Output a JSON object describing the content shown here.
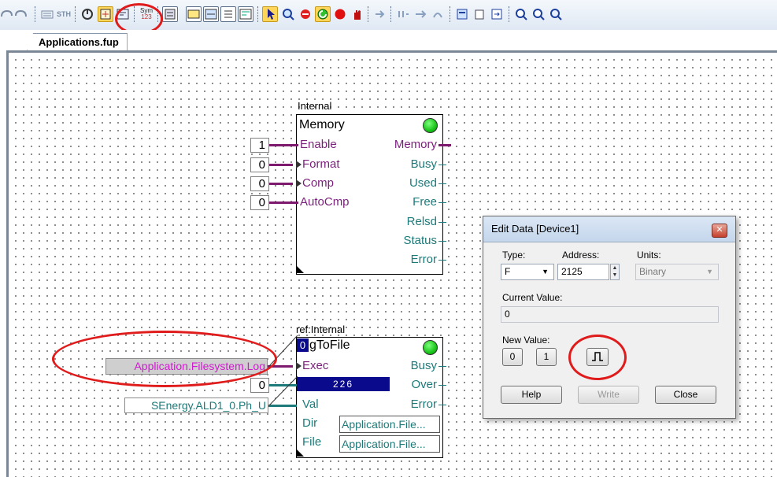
{
  "tab": {
    "label": "Applications.fup"
  },
  "toolbar": {
    "sym_label": "Sym",
    "sym_num": "123",
    "sth_label": "STH"
  },
  "memory_block": {
    "scope": "Internal",
    "title": "Memory",
    "inputs": [
      {
        "name": "Enable",
        "value": "1"
      },
      {
        "name": "Format",
        "value": "0"
      },
      {
        "name": "Comp",
        "value": "0"
      },
      {
        "name": "AutoCmp",
        "value": "0"
      }
    ],
    "outputs": [
      "Memory",
      "Busy",
      "Used",
      "Free",
      "Relsd",
      "Status",
      "Error"
    ]
  },
  "log_block": {
    "scope": "ref:Internal",
    "title_prefix": "0",
    "title": "gToFile",
    "exec_source": "Application.Filesystem.Log",
    "number_input": "0",
    "counter_value": "226",
    "val_source": "SEnergy.ALD1_0.Ph_U",
    "inputs": [
      "Exec",
      "Val",
      "Dir",
      "File"
    ],
    "outputs": [
      "Busy",
      "Over",
      "Error"
    ],
    "dir_value": "Application.File...",
    "file_value": "Application.File..."
  },
  "dialog": {
    "title": "Edit Data [Device1]",
    "type_label": "Type:",
    "type_value": "F",
    "address_label": "Address:",
    "address_value": "2125",
    "units_label": "Units:",
    "units_value": "Binary",
    "current_label": "Current Value:",
    "current_value": "0",
    "new_label": "New Value:",
    "btn_zero": "0",
    "btn_one": "1",
    "help_label": "Help",
    "write_label": "Write",
    "close_label": "Close"
  }
}
